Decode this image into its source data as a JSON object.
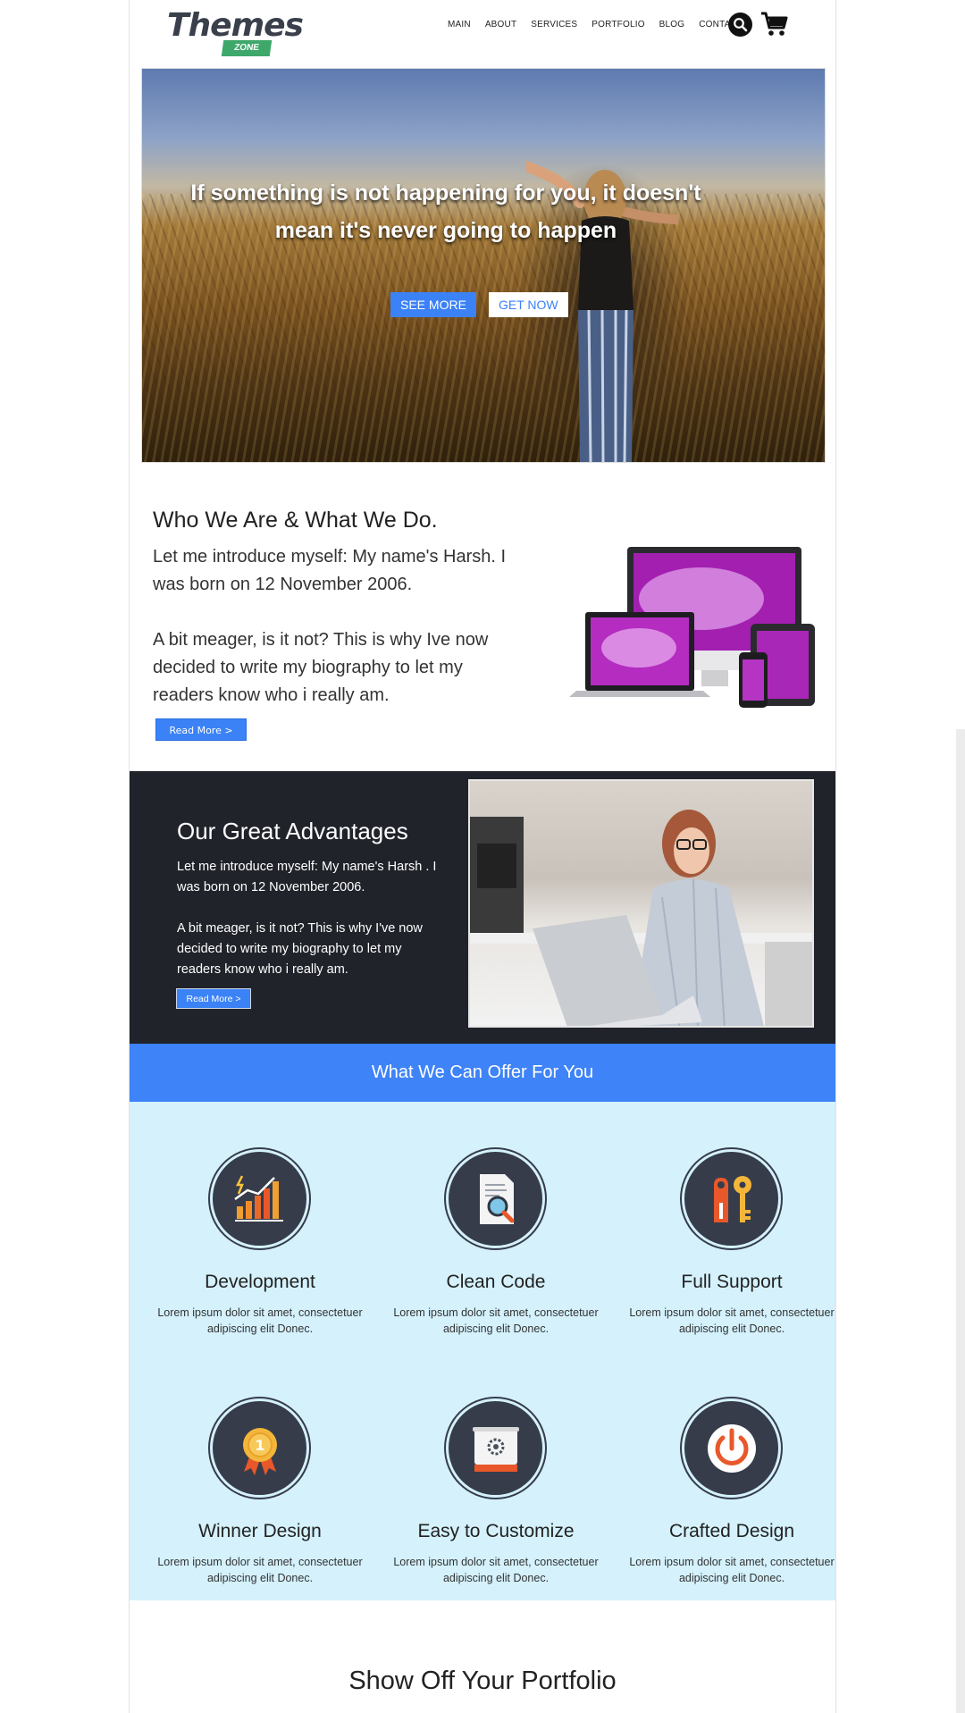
{
  "header": {
    "logo_text": "Themes",
    "logo_ribbon": "ZONE",
    "nav": [
      "MAIN",
      "ABOUT",
      "SERVICES",
      "PORTFOLIO",
      "BLOG",
      "CONTACT"
    ]
  },
  "hero": {
    "title": "If something is not happening for you, it doesn't mean it's never going to happen",
    "btn_see_more": "SEE MORE",
    "btn_get_now": "GET NOW"
  },
  "who": {
    "heading": "Who We Are & What We Do.",
    "paragraph1": "Let me introduce myself: My name's Harsh. I was born on 12 November 2006.",
    "paragraph2": "A bit meager, is it not? This is why Ive now decided to write my biography to let my readers know who i really am.",
    "read_more": "Read More >"
  },
  "advantages": {
    "heading": "Our Great Advantages",
    "paragraph1": "Let me introduce myself: My name's Harsh . I was born on 12 November 2006.",
    "paragraph2": "A bit meager, is it not? This is why I've now decided to write my biography to let my readers know who i really am.",
    "read_more": "Read More >"
  },
  "offer": {
    "heading": "What We Can Offer For You",
    "features": [
      {
        "title": "Development",
        "text": "Lorem ipsum dolor sit amet, consectetuer adipiscing elit Donec.",
        "icon": "chart-growth-icon"
      },
      {
        "title": "Clean Code",
        "text": "Lorem ipsum dolor sit amet, consectetuer adipiscing elit Donec.",
        "icon": "document-magnifier-icon"
      },
      {
        "title": "Full Support",
        "text": "Lorem ipsum dolor sit amet, consectetuer adipiscing elit Donec.",
        "icon": "tag-key-icon"
      },
      {
        "title": "Winner Design",
        "text": "Lorem ipsum dolor sit amet, consectetuer adipiscing elit Donec.",
        "icon": "medal-icon"
      },
      {
        "title": "Easy to Customize",
        "text": "Lorem ipsum dolor sit amet, consectetuer adipiscing elit Donec.",
        "icon": "gear-scroll-icon"
      },
      {
        "title": "Crafted Design",
        "text": "Lorem ipsum dolor sit amet, consectetuer adipiscing elit Donec.",
        "icon": "power-icon"
      }
    ]
  },
  "portfolio": {
    "heading": "Show Off Your Portfolio"
  },
  "colors": {
    "accent": "#3e83f7",
    "dark_section": "#20232a",
    "features_bg": "#d4f1fc",
    "icon_circle": "#363c4a"
  }
}
